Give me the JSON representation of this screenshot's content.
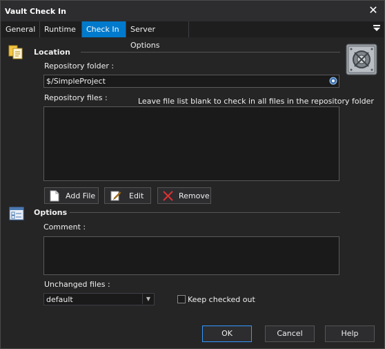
{
  "window": {
    "title": "Vault Check In",
    "close_glyph": "✕"
  },
  "tabs": [
    {
      "label": "General",
      "active": false
    },
    {
      "label": "Runtime",
      "active": false
    },
    {
      "label": "Check In",
      "active": true
    },
    {
      "label": "Server Options",
      "active": false
    }
  ],
  "location": {
    "title": "Location",
    "repository_folder_label": "Repository folder :",
    "repository_folder_value": "$/SimpleProject",
    "repository_files_label": "Repository files :",
    "hint": "Leave file list blank to check in all files in the repository folder",
    "buttons": {
      "add_file": "Add File",
      "edit": "Edit",
      "remove": "Remove"
    }
  },
  "options": {
    "title": "Options",
    "comment_label": "Comment :",
    "comment_value": "",
    "unchanged_files_label": "Unchanged files :",
    "unchanged_files_value": "default",
    "keep_checked_out_label": "Keep checked out",
    "keep_checked_out": false
  },
  "footer": {
    "ok": "OK",
    "cancel": "Cancel",
    "help": "Help"
  },
  "colors": {
    "accent": "#007acc",
    "background": "#252526",
    "remove_x": "#e03030"
  },
  "icons": [
    "files-icon",
    "options-icon",
    "vault-icon",
    "file-icon",
    "edit-icon",
    "remove-icon",
    "browse-icon",
    "chevron-down-icon",
    "menu-icon",
    "close-icon"
  ]
}
